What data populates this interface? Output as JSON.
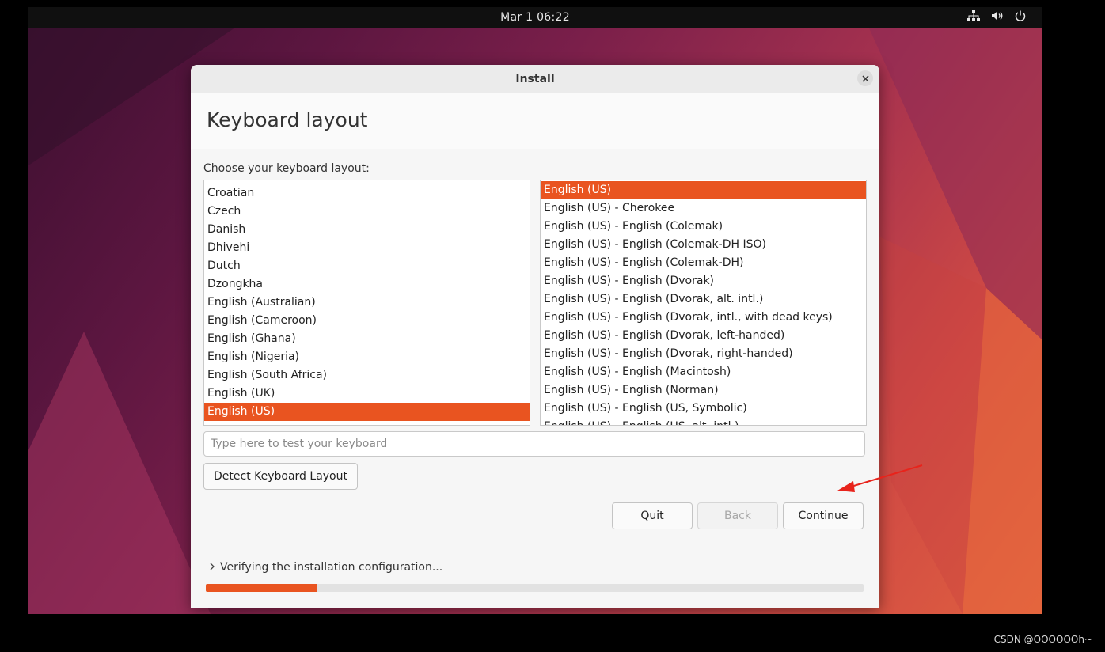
{
  "topbar": {
    "datetime": "Mar 1  06:22",
    "icons": [
      "network-icon",
      "volume-icon",
      "power-icon"
    ]
  },
  "window": {
    "title": "Install",
    "page_title": "Keyboard layout",
    "choose_label": "Choose your keyboard layout:",
    "layouts": [
      {
        "label": "Croatian",
        "selected": false
      },
      {
        "label": "Czech",
        "selected": false
      },
      {
        "label": "Danish",
        "selected": false
      },
      {
        "label": "Dhivehi",
        "selected": false
      },
      {
        "label": "Dutch",
        "selected": false
      },
      {
        "label": "Dzongkha",
        "selected": false
      },
      {
        "label": "English (Australian)",
        "selected": false
      },
      {
        "label": "English (Cameroon)",
        "selected": false
      },
      {
        "label": "English (Ghana)",
        "selected": false
      },
      {
        "label": "English (Nigeria)",
        "selected": false
      },
      {
        "label": "English (South Africa)",
        "selected": false
      },
      {
        "label": "English (UK)",
        "selected": false
      },
      {
        "label": "English (US)",
        "selected": true
      }
    ],
    "variants": [
      {
        "label": "English (US)",
        "selected": true
      },
      {
        "label": "English (US) - Cherokee",
        "selected": false
      },
      {
        "label": "English (US) - English (Colemak)",
        "selected": false
      },
      {
        "label": "English (US) - English (Colemak-DH ISO)",
        "selected": false
      },
      {
        "label": "English (US) - English (Colemak-DH)",
        "selected": false
      },
      {
        "label": "English (US) - English (Dvorak)",
        "selected": false
      },
      {
        "label": "English (US) - English (Dvorak, alt. intl.)",
        "selected": false
      },
      {
        "label": "English (US) - English (Dvorak, intl., with dead keys)",
        "selected": false
      },
      {
        "label": "English (US) - English (Dvorak, left-handed)",
        "selected": false
      },
      {
        "label": "English (US) - English (Dvorak, right-handed)",
        "selected": false
      },
      {
        "label": "English (US) - English (Macintosh)",
        "selected": false
      },
      {
        "label": "English (US) - English (Norman)",
        "selected": false
      },
      {
        "label": "English (US) - English (US, Symbolic)",
        "selected": false
      },
      {
        "label": "English (US) - English (US, alt. intl.)",
        "selected": false
      }
    ],
    "test_input": {
      "value": "",
      "placeholder": "Type here to test your keyboard"
    },
    "detect_button": "Detect Keyboard Layout",
    "buttons": {
      "quit": "Quit",
      "back": "Back",
      "continue": "Continue"
    },
    "status_text": "Verifying the installation configuration...",
    "progress": 0.17
  },
  "colors": {
    "accent": "#e95420",
    "topbar": "#101010"
  },
  "watermark": "CSDN @OOOOOOh~"
}
